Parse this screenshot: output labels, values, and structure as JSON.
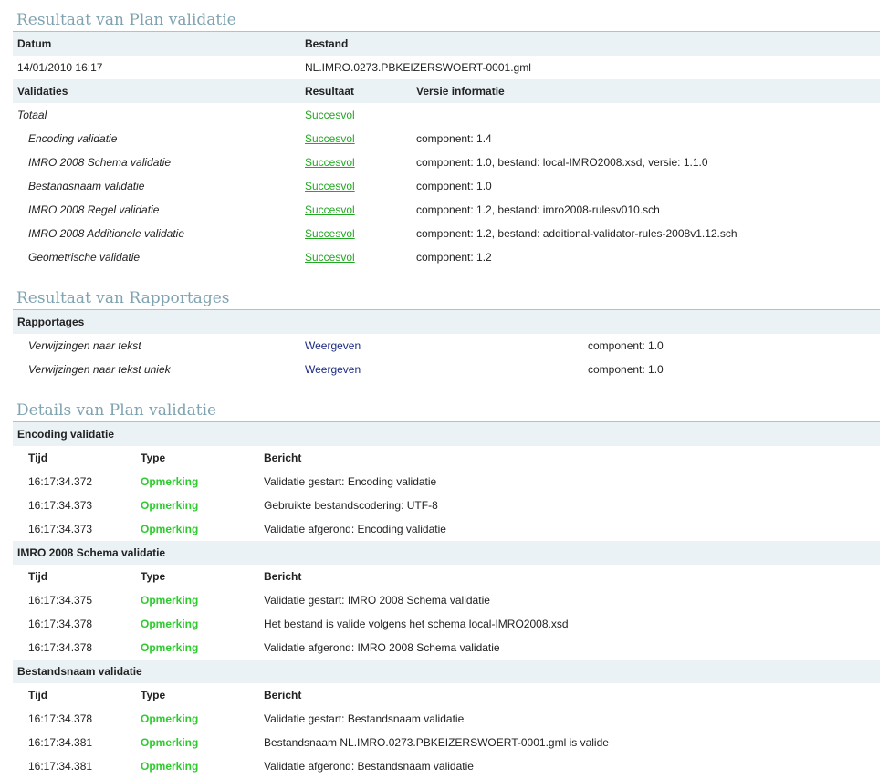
{
  "plan": {
    "title": "Resultaat van Plan validatie",
    "col_datum": "Datum",
    "col_bestand": "Bestand",
    "datum": "14/01/2010 16:17",
    "bestand": "NL.IMRO.0273.PBKEIZERSWOERT-0001.gml",
    "col_validaties": "Validaties",
    "col_resultaat": "Resultaat",
    "col_versie": "Versie informatie",
    "totaal_label": "Totaal",
    "totaal_result": "Succesvol",
    "rows": [
      {
        "name": "Encoding validatie",
        "result": "Succesvol",
        "info": "component: 1.4"
      },
      {
        "name": "IMRO 2008 Schema validatie",
        "result": "Succesvol",
        "info": "component: 1.0, bestand: local-IMRO2008.xsd, versie: 1.1.0"
      },
      {
        "name": "Bestandsnaam validatie",
        "result": "Succesvol",
        "info": "component: 1.0"
      },
      {
        "name": "IMRO 2008 Regel validatie",
        "result": "Succesvol",
        "info": "component: 1.2, bestand: imro2008-rulesv010.sch"
      },
      {
        "name": "IMRO 2008 Additionele validatie",
        "result": "Succesvol",
        "info": "component: 1.2, bestand: additional-validator-rules-2008v1.12.sch"
      },
      {
        "name": "Geometrische validatie",
        "result": "Succesvol",
        "info": "component: 1.2"
      }
    ]
  },
  "rapport": {
    "title": "Resultaat van Rapportages",
    "col_rapportages": "Rapportages",
    "rows": [
      {
        "name": "Verwijzingen naar tekst",
        "action": "Weergeven",
        "info": "component: 1.0"
      },
      {
        "name": "Verwijzingen naar tekst uniek",
        "action": "Weergeven",
        "info": "component: 1.0"
      }
    ]
  },
  "details": {
    "title": "Details van Plan validatie",
    "col_tijd": "Tijd",
    "col_type": "Type",
    "col_bericht": "Bericht",
    "groups": [
      {
        "name": "Encoding validatie",
        "entries": [
          {
            "tijd": "16:17:34.372",
            "type": "Opmerking",
            "bericht": "Validatie gestart: Encoding validatie"
          },
          {
            "tijd": "16:17:34.373",
            "type": "Opmerking",
            "bericht": "Gebruikte bestandscodering: UTF-8"
          },
          {
            "tijd": "16:17:34.373",
            "type": "Opmerking",
            "bericht": "Validatie afgerond: Encoding validatie"
          }
        ]
      },
      {
        "name": "IMRO 2008 Schema validatie",
        "entries": [
          {
            "tijd": "16:17:34.375",
            "type": "Opmerking",
            "bericht": "Validatie gestart: IMRO 2008 Schema validatie"
          },
          {
            "tijd": "16:17:34.378",
            "type": "Opmerking",
            "bericht": "Het bestand is valide volgens het schema local-IMRO2008.xsd"
          },
          {
            "tijd": "16:17:34.378",
            "type": "Opmerking",
            "bericht": "Validatie afgerond: IMRO 2008 Schema validatie"
          }
        ]
      },
      {
        "name": "Bestandsnaam validatie",
        "entries": [
          {
            "tijd": "16:17:34.378",
            "type": "Opmerking",
            "bericht": "Validatie gestart: Bestandsnaam validatie"
          },
          {
            "tijd": "16:17:34.381",
            "type": "Opmerking",
            "bericht": "Bestandsnaam NL.IMRO.0273.PBKEIZERSWOERT-0001.gml is valide"
          },
          {
            "tijd": "16:17:34.381",
            "type": "Opmerking",
            "bericht": "Validatie afgerond: Bestandsnaam validatie"
          }
        ]
      }
    ]
  }
}
